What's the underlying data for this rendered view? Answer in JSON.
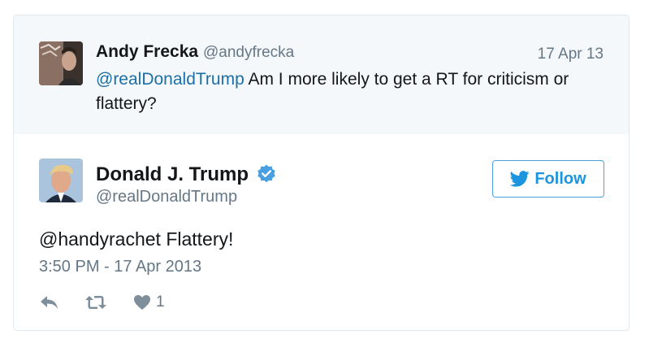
{
  "quoted_tweet": {
    "name": "Andy Frecka",
    "handle": "@andyfrecka",
    "date": "17 Apr 13",
    "mention": "@realDonaldTrump",
    "text": " Am I more likely to get a RT for criticism or flattery?"
  },
  "main_tweet": {
    "name": "Donald J. Trump",
    "handle": "@realDonaldTrump",
    "verified": true,
    "text": "@handyrachet Flattery!",
    "timestamp": "3:50 PM - 17 Apr 2013",
    "follow_label": "Follow",
    "like_count": "1"
  },
  "icons": {
    "reply": "reply-icon",
    "retweet": "retweet-icon",
    "like": "heart-icon",
    "follow": "bird-icon",
    "verified": "verified-badge-icon"
  },
  "colors": {
    "link": "#1b6fa6",
    "accent": "#1b95e0",
    "muted": "#657786"
  }
}
